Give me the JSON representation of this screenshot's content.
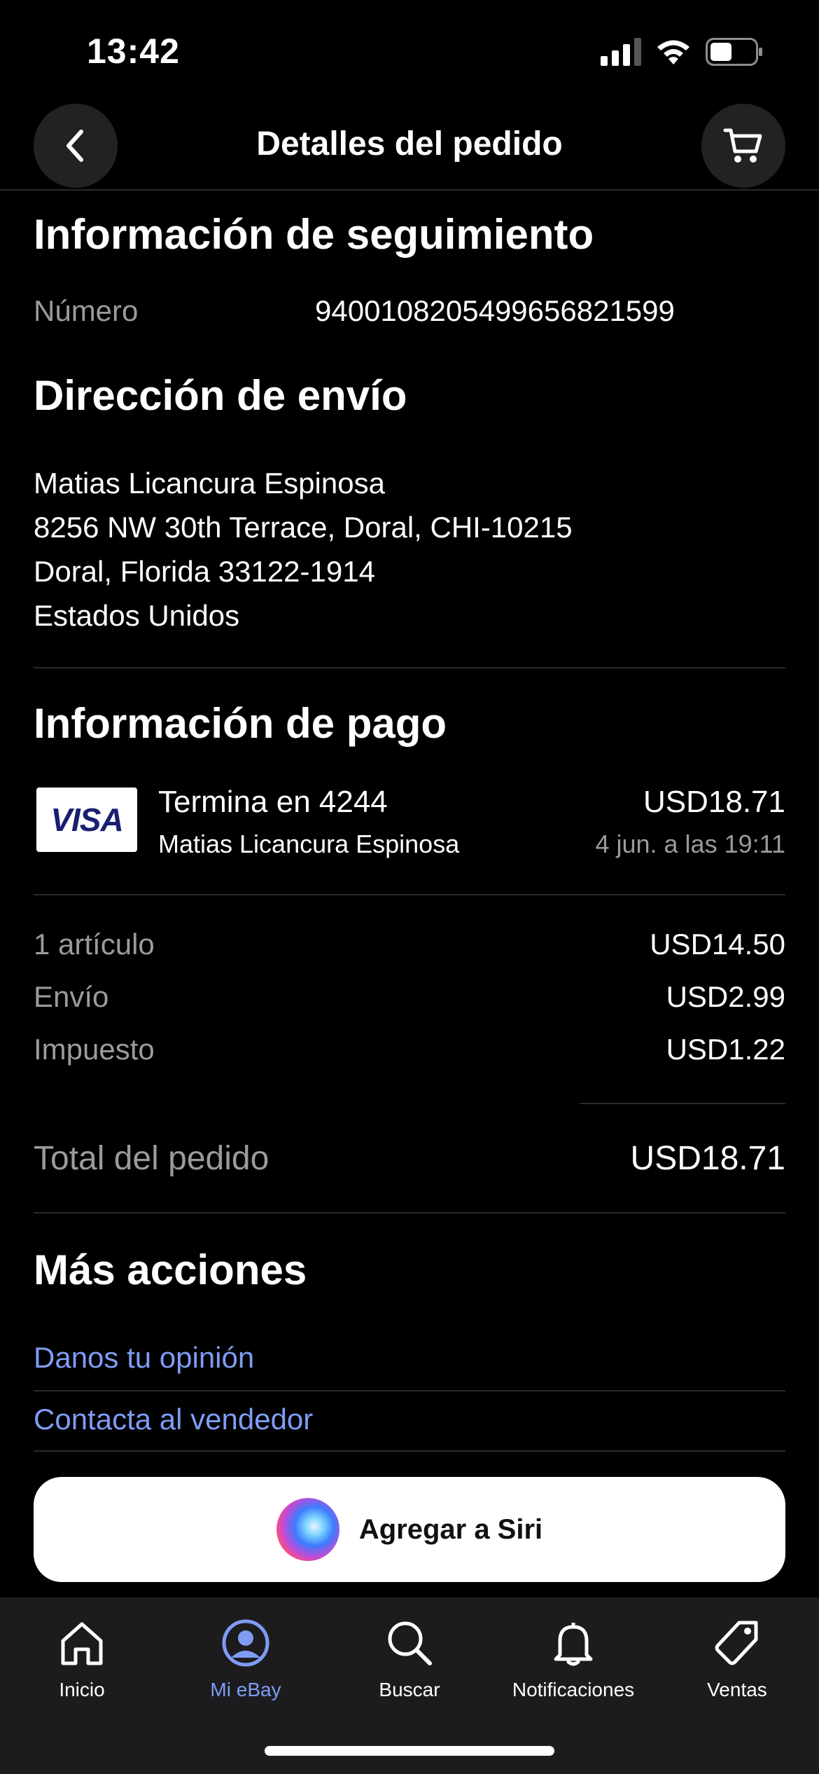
{
  "status_bar": {
    "time": "13:42"
  },
  "nav": {
    "title": "Detalles del pedido",
    "back_icon": "chevron-left-icon",
    "cart_icon": "cart-icon"
  },
  "tracking": {
    "title": "Información de seguimiento",
    "number_label": "Número",
    "number_value": "9400108205499656821599"
  },
  "shipping": {
    "title": "Dirección de envío",
    "lines": [
      "Matias Licancura Espinosa",
      "8256 NW 30th Terrace, Doral, CHI-10215",
      "Doral, Florida 33122-1914",
      "Estados Unidos"
    ]
  },
  "payment": {
    "title": "Información de pago",
    "card_brand": "VISA",
    "card_line": "Termina en 4244",
    "card_holder": "Matias Licancura Espinosa",
    "amount": "USD18.71",
    "date": "4 jun. a las 19:11"
  },
  "summary": {
    "rows": [
      {
        "label": "1 artículo",
        "value": "USD14.50"
      },
      {
        "label": "Envío",
        "value": "USD2.99"
      },
      {
        "label": "Impuesto",
        "value": "USD1.22"
      }
    ],
    "total_label": "Total del pedido",
    "total_value": "USD18.71"
  },
  "actions": {
    "title": "Más acciones",
    "links": [
      "Danos tu opinión",
      "Contacta al vendedor"
    ]
  },
  "siri": {
    "label": "Agregar a Siri"
  },
  "tabs": [
    {
      "label": "Inicio",
      "icon": "home-icon",
      "active": false
    },
    {
      "label": "Mi eBay",
      "icon": "profile-icon",
      "active": true
    },
    {
      "label": "Buscar",
      "icon": "search-icon",
      "active": false
    },
    {
      "label": "Notificaciones",
      "icon": "bell-icon",
      "active": false
    },
    {
      "label": "Ventas",
      "icon": "tag-icon",
      "active": false
    }
  ],
  "colors": {
    "background": "#000000",
    "link": "#7f9cf5",
    "muted": "#9b9b9b",
    "tab_bar": "#1c1c1e"
  }
}
